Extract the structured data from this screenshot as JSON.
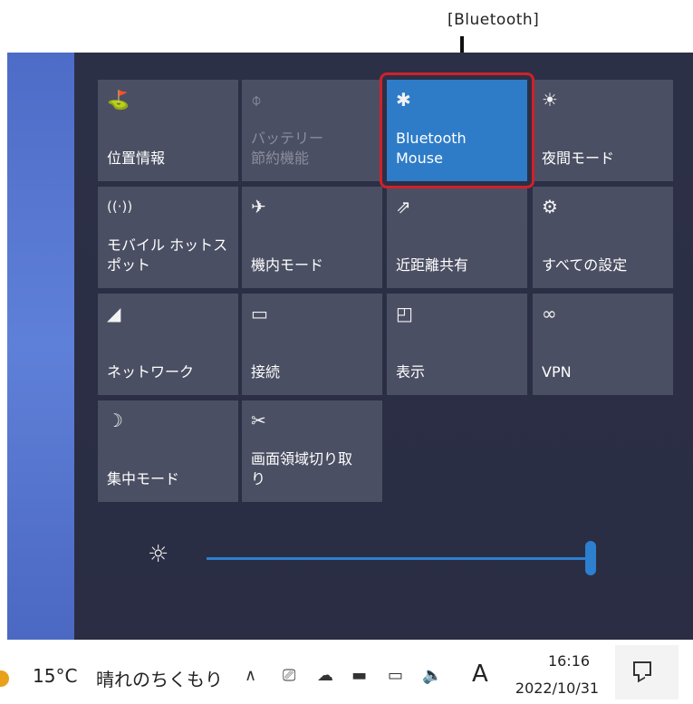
{
  "callout": {
    "label": "[Bluetooth]"
  },
  "tiles": [
    {
      "icon": "location-icon",
      "glyph": "⛳",
      "label": "位置情報",
      "state": "normal"
    },
    {
      "icon": "battery-saver-icon",
      "glyph": "⌽",
      "label": "バッテリー\n節約機能",
      "state": "disabled"
    },
    {
      "icon": "bluetooth-icon",
      "glyph": "✱",
      "label": "Bluetooth\nMouse",
      "state": "active"
    },
    {
      "icon": "night-light-icon",
      "glyph": "☀",
      "label": "夜間モード",
      "state": "normal"
    },
    {
      "icon": "mobile-hotspot-icon",
      "glyph": "((·))",
      "label": "モバイル ホットス\nポット",
      "state": "normal"
    },
    {
      "icon": "airplane-icon",
      "glyph": "✈",
      "label": "機内モード",
      "state": "normal"
    },
    {
      "icon": "nearby-sharing-icon",
      "glyph": "⇗",
      "label": "近距離共有",
      "state": "normal"
    },
    {
      "icon": "settings-gear-icon",
      "glyph": "⚙",
      "label": "すべての設定",
      "state": "normal"
    },
    {
      "icon": "network-icon",
      "glyph": "◢",
      "label": "ネットワーク",
      "state": "normal"
    },
    {
      "icon": "connect-icon",
      "glyph": "▭",
      "label": "接続",
      "state": "normal"
    },
    {
      "icon": "project-icon",
      "glyph": "◰",
      "label": "表示",
      "state": "normal"
    },
    {
      "icon": "vpn-icon",
      "glyph": "∞",
      "label": "VPN",
      "state": "normal"
    },
    {
      "icon": "focus-assist-icon",
      "glyph": "☽",
      "label": "集中モード",
      "state": "normal"
    },
    {
      "icon": "snip-icon",
      "glyph": "✂",
      "label": "画面領域切り取\nり",
      "state": "normal"
    }
  ],
  "brightness": {
    "icon": "brightness-icon",
    "glyph": "☼",
    "level": 1.0
  },
  "taskbar": {
    "weather_temp": "15°C",
    "weather_text": "晴れのちくもり",
    "tray_chevron": "∧",
    "tray_meet": "⎚",
    "tray_cloud": "☁",
    "tray_battery": "▬",
    "tray_network": "▭",
    "tray_volume": "🔈",
    "ime": "A",
    "time": "16:16",
    "date": "2022/10/31"
  },
  "colors": {
    "active_tile": "#2e7cc8",
    "highlight": "#d0212a",
    "slider": "#2d7fd0"
  }
}
